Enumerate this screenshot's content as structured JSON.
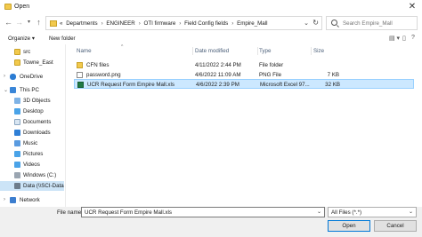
{
  "window": {
    "title": "Open"
  },
  "address": {
    "crumbs": [
      "«",
      "Departments",
      "ENGINEER",
      "OTI firmware",
      "Field Config fields",
      "Empire_Mall"
    ],
    "separator": "›"
  },
  "search": {
    "placeholder": "Search Empire_Mall"
  },
  "toolbar": {
    "organize_label": "Organize ▾",
    "new_folder_label": "New folder"
  },
  "sidebar": {
    "items": [
      {
        "label": "src",
        "icon": "folder-icon"
      },
      {
        "label": "Towne_East",
        "icon": "folder-icon"
      },
      {
        "label": "OneDrive",
        "icon": "cloud-icon"
      },
      {
        "label": "This PC",
        "icon": "computer-icon"
      },
      {
        "label": "3D Objects",
        "icon": "cube-icon"
      },
      {
        "label": "Desktop",
        "icon": "desktop-icon"
      },
      {
        "label": "Documents",
        "icon": "documents-icon"
      },
      {
        "label": "Downloads",
        "icon": "download-icon"
      },
      {
        "label": "Music",
        "icon": "music-icon"
      },
      {
        "label": "Pictures",
        "icon": "pictures-icon"
      },
      {
        "label": "Videos",
        "icon": "videos-icon"
      },
      {
        "label": "Windows (C:)",
        "icon": "drive-icon"
      },
      {
        "label": "Data (\\\\SCI-Data",
        "icon": "network-drive-icon"
      },
      {
        "label": "Network",
        "icon": "network-icon"
      }
    ]
  },
  "columns": {
    "name": "Name",
    "date": "Date modified",
    "type": "Type",
    "size": "Size"
  },
  "files": [
    {
      "name": "CFN files",
      "date": "4/11/2022 2:44 PM",
      "type": "File folder",
      "size": ""
    },
    {
      "name": "password.png",
      "date": "4/6/2022 11:09 AM",
      "type": "PNG File",
      "size": "7 KB"
    },
    {
      "name": "UCR Request Form Empire Mall.xls",
      "date": "4/6/2022 2:39 PM",
      "type": "Microsoft Excel 97...",
      "size": "32 KB"
    }
  ],
  "footer": {
    "file_name_label": "File name:",
    "file_name_value": "UCR Request Form Empire Mall.xls",
    "filter_value": "All Files (*.*)",
    "open_label": "Open",
    "cancel_label": "Cancel"
  },
  "colors": {
    "selection": "#cce8ff",
    "accent": "#0078d7",
    "folder": "#f2c94c"
  }
}
